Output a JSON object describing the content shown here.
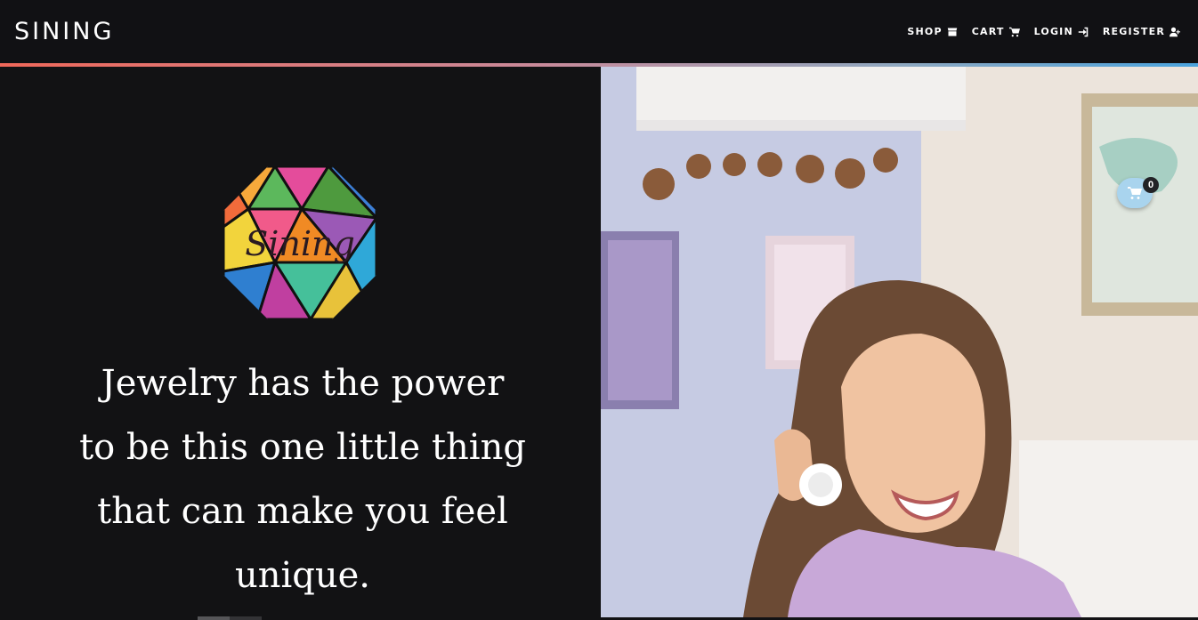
{
  "brand": {
    "name": "SINING"
  },
  "nav": {
    "items": [
      {
        "label": "SHOP",
        "icon": "store-icon"
      },
      {
        "label": "CART",
        "icon": "cart-icon"
      },
      {
        "label": "LOGIN",
        "icon": "login-icon"
      },
      {
        "label": "REGISTER",
        "icon": "user-plus-icon"
      }
    ]
  },
  "hero": {
    "logo_text": "Sining",
    "quote_lines": [
      "Jewelry has the power",
      "to be this one little thing",
      "that can make you feel",
      "unique."
    ]
  },
  "floating_cart": {
    "count": "0",
    "icon": "cart-icon"
  },
  "colors": {
    "navbar_bg": "#111114",
    "accent_start": "#f0685a",
    "accent_end": "#4aa3dd",
    "floating_cart_bg": "#a9d4ee"
  }
}
